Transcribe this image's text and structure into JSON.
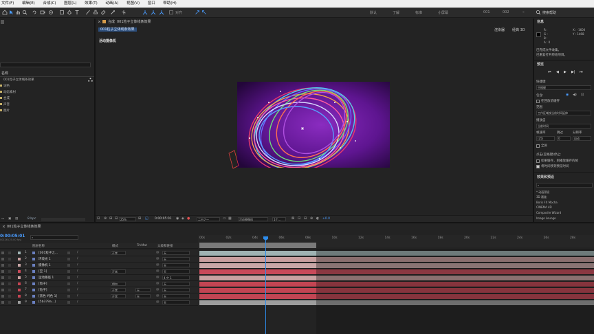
{
  "menu": {
    "items": [
      "文件(F)",
      "编辑(E)",
      "合成(C)",
      "图层(L)",
      "效果(T)",
      "动画(A)",
      "视图(V)",
      "窗口",
      "帮助(H)"
    ]
  },
  "toolbar": {
    "align_label": "对齐",
    "workspaces": [
      "默认",
      "了解",
      "标准",
      "小屏幕",
      "001",
      "002"
    ],
    "search_placeholder": "搜索帮助"
  },
  "comp_panel": {
    "tab_prefix": "合成",
    "tab_name": "001粒子立体线条效果",
    "subtab": "001粒子立体线条效果",
    "renderer_label": "渲染器",
    "renderer_value": "经典 3D",
    "camera_label": "活动摄像机",
    "zoom": "25%",
    "timecode": "0:00:05:01",
    "resolution": "二分之一",
    "camera_select": "活动摄像机",
    "views": "1个...",
    "exposure": "+0.0"
  },
  "project_panel": {
    "header": "名称",
    "items": [
      "001粒子立体线条效果",
      "词色",
      "动态素材",
      "合成",
      "声音",
      "图片"
    ],
    "bpc": "8 bpc"
  },
  "info_panel": {
    "title": "信息",
    "channels": [
      "R :",
      "G :",
      "B :",
      "A : 0"
    ],
    "coords": [
      "X : -1600",
      "Y : 1468"
    ],
    "messages": [
      "已完成文件收集。",
      "已重复打开原始项目。"
    ]
  },
  "preview_panel": {
    "title": "预览",
    "shortcut_label": "快捷键",
    "shortcut_value": "空格键",
    "include_label": "包含:",
    "cache_label": "在回放前缓存",
    "range_label": "范围",
    "range_value": "工作区域按当前时间延伸",
    "play_from_label": "播放自",
    "play_from_value": "当前时间",
    "fps_label": "帧速率",
    "skip_label": "跳过",
    "res_label": "分辨率",
    "fps_value": "(25)",
    "skip_value": "0",
    "res_value": "自动",
    "fullscreen_label": "全屏",
    "stop_label": "点击(空格键)停止:",
    "opt1": "如果缓存，则播放缓存的帧",
    "opt2": "将时间移到预览时间"
  },
  "effects_panel": {
    "title": "效果和预设",
    "items": [
      "* 动画预设",
      "3D 通道",
      "Boris FX Mocha",
      "CINEMA 4D",
      "Composite Wizard",
      "Image Lounge"
    ]
  },
  "timeline": {
    "tab": "001粒子立体线条效果",
    "timecode": "0:00:05:01",
    "frame_info": "00126 (25.00 fps)",
    "headers": {
      "layer_name": "图层名称",
      "mode": "模式",
      "trkmat": "TrkMat",
      "parent": "父级和链接"
    },
    "ruler": [
      "00s",
      "02s",
      "04s",
      "06s",
      "08s",
      "10s",
      "12s",
      "14s",
      "16s",
      "18s",
      "20s",
      "22s",
      "24s",
      "26s",
      "28s",
      "30s"
    ],
    "layers": [
      {
        "num": "1",
        "name": "[001粒子之...",
        "mode": "正常",
        "trk": "",
        "parent": "无",
        "color": "#9fb3b3"
      },
      {
        "num": "2",
        "name": "环境光 1",
        "mode": "",
        "trk": "",
        "parent": "无",
        "color": "#c89f9f"
      },
      {
        "num": "3",
        "name": "摄像机 1",
        "mode": "",
        "trk": "",
        "parent": "无",
        "color": "#c8a6a6"
      },
      {
        "num": "4",
        "name": "[空 1]",
        "mode": "正常",
        "trk": "",
        "parent": "无",
        "color": "#c94a5a"
      },
      {
        "num": "5",
        "name": "运动路径 1",
        "mode": "",
        "trk": "",
        "parent": "4.空 1",
        "color": "#c9a2a2"
      },
      {
        "num": "6",
        "name": "[粒子]",
        "mode": "相加",
        "trk": "",
        "parent": "无",
        "color": "#c34553"
      },
      {
        "num": "7",
        "name": "[粒子]",
        "mode": "正常",
        "trk": "无",
        "parent": "无",
        "color": "#c34553"
      },
      {
        "num": "8",
        "name": "[黑色 纯色 1]",
        "mode": "正常",
        "trk": "无",
        "parent": "无",
        "color": "#c34553"
      },
      {
        "num": "9",
        "name": "[5b379a...]",
        "mode": "",
        "trk": "",
        "parent": "无",
        "color": "#9e9e9e"
      }
    ]
  },
  "colors": {
    "accent": "#2d8ceb",
    "panel": "#232323",
    "playhead": "#2d8ceb"
  }
}
